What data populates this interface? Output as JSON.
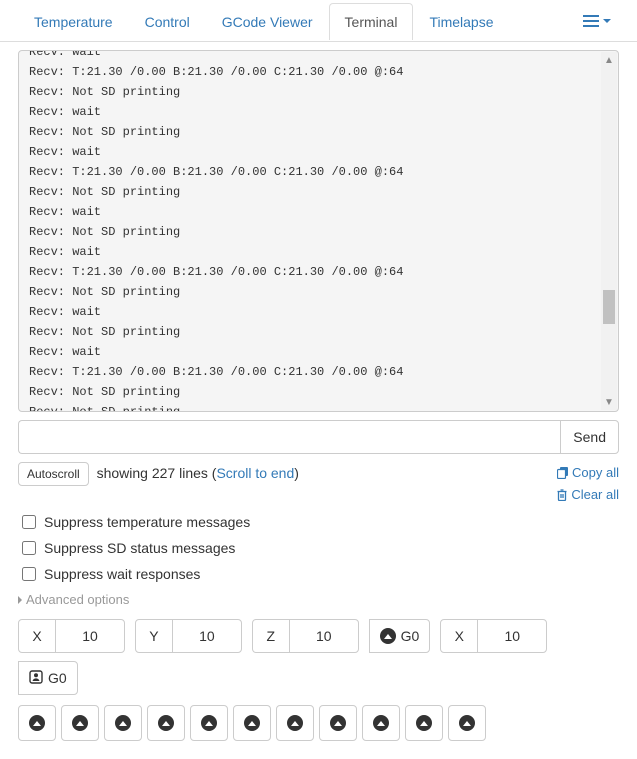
{
  "tabs": {
    "temperature": "Temperature",
    "control": "Control",
    "gcode": "GCode Viewer",
    "terminal": "Terminal",
    "timelapse": "Timelapse",
    "active": "terminal"
  },
  "terminal": {
    "lines": [
      "Recv: wait",
      "Recv: T:21.30 /0.00 B:21.30 /0.00 C:21.30 /0.00 @:64",
      "Recv: Not SD printing",
      "Recv: wait",
      "Recv: Not SD printing",
      "Recv: wait",
      "Recv: T:21.30 /0.00 B:21.30 /0.00 C:21.30 /0.00 @:64",
      "Recv: Not SD printing",
      "Recv: wait",
      "Recv: Not SD printing",
      "Recv: wait",
      "Recv: T:21.30 /0.00 B:21.30 /0.00 C:21.30 /0.00 @:64",
      "Recv: Not SD printing",
      "Recv: wait",
      "Recv: Not SD printing",
      "Recv: wait",
      "Recv: T:21.30 /0.00 B:21.30 /0.00 C:21.30 /0.00 @:64",
      "Recv: Not SD printing",
      "Recv: Not SD printing"
    ]
  },
  "command": {
    "value": "",
    "placeholder": ""
  },
  "send_label": "Send",
  "autoscroll_label": "Autoscroll",
  "status": {
    "prefix": "showing ",
    "count": "227",
    "mid": " lines (",
    "scroll_link": "Scroll to end",
    "suffix": ")"
  },
  "actions": {
    "copy": "Copy all",
    "clear": "Clear all"
  },
  "filters": {
    "temp": "Suppress temperature messages",
    "sd": "Suppress SD status messages",
    "wait": "Suppress wait responses"
  },
  "advanced": "Advanced options",
  "jog": {
    "x": "X",
    "xv": "10",
    "y": "Y",
    "yv": "10",
    "z": "Z",
    "zv": "10",
    "g0a": "G0",
    "x2": "X",
    "x2v": "10",
    "g0b": "G0"
  }
}
